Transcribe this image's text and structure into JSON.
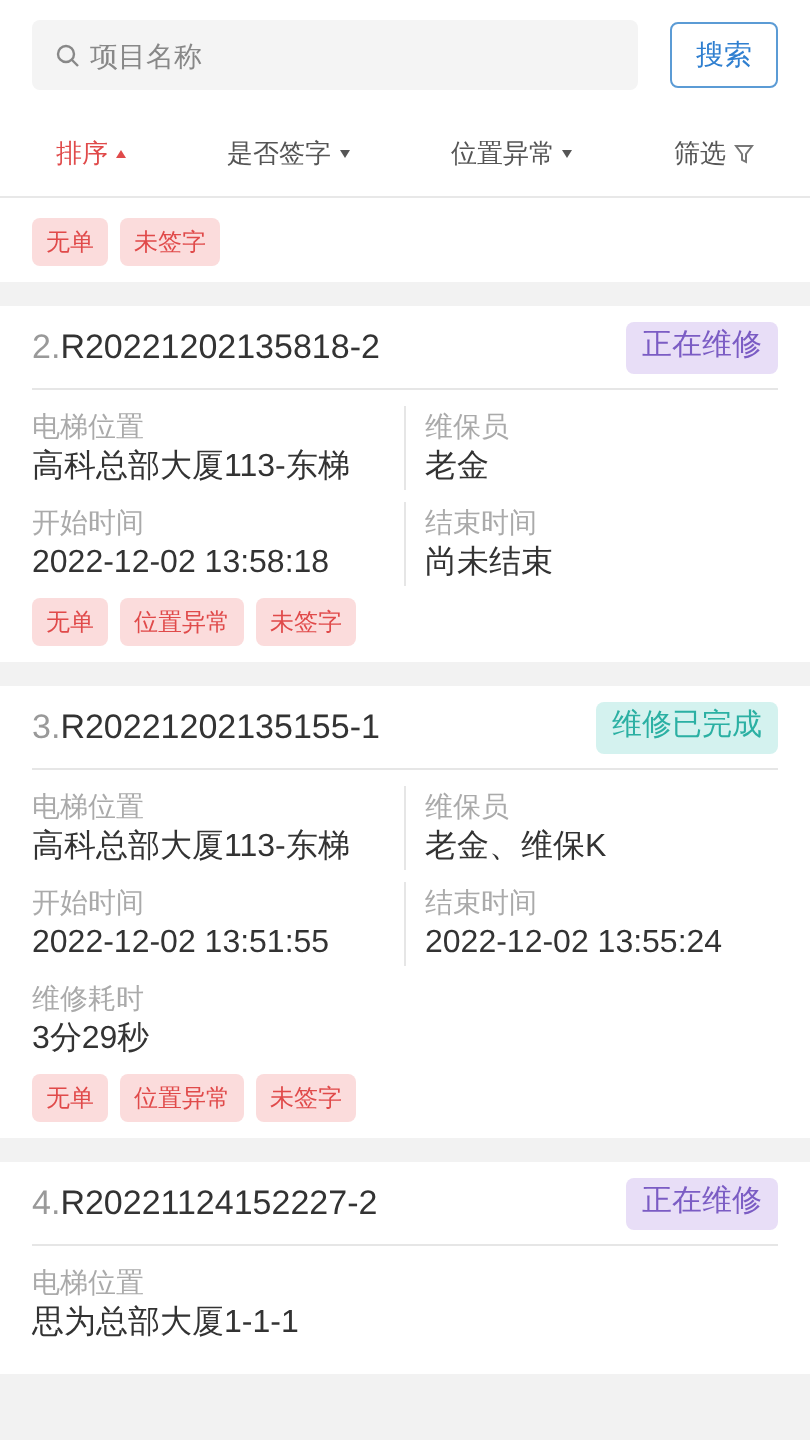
{
  "search": {
    "placeholder": "项目名称",
    "button": "搜索"
  },
  "filters": [
    {
      "label": "排序",
      "selected": true,
      "kind": "dropdown"
    },
    {
      "label": "是否签字",
      "selected": false,
      "kind": "dropdown"
    },
    {
      "label": "位置异常",
      "selected": false,
      "kind": "dropdown"
    },
    {
      "label": "筛选",
      "selected": false,
      "kind": "filter"
    }
  ],
  "partial_card": {
    "tags": [
      "无单",
      "未签字"
    ]
  },
  "orders": [
    {
      "index": "2.",
      "code": "R20221202135818-2",
      "status": "正在维修",
      "kind": "in_progress",
      "fields": [
        {
          "label": "电梯位置",
          "value": "高科总部大厦113-东梯"
        },
        {
          "label": "维保员",
          "value": "老金"
        },
        {
          "label": "开始时间",
          "value": "2022-12-02 13:58:18"
        },
        {
          "label": "结束时间",
          "value": "尚未结束"
        }
      ],
      "tags": [
        "无单",
        "位置异常",
        "未签字"
      ]
    },
    {
      "index": "3.",
      "code": "R20221202135155-1",
      "status": "维修已完成",
      "kind": "done",
      "fields": [
        {
          "label": "电梯位置",
          "value": "高科总部大厦113-东梯"
        },
        {
          "label": "维保员",
          "value": "老金、维保K"
        },
        {
          "label": "开始时间",
          "value": "2022-12-02 13:51:55"
        },
        {
          "label": "结束时间",
          "value": "2022-12-02 13:55:24"
        },
        {
          "label": "维修耗时",
          "value": "3分29秒"
        }
      ],
      "tags": [
        "无单",
        "位置异常",
        "未签字"
      ]
    },
    {
      "index": "4.",
      "code": "R20221124152227-2",
      "status": "正在维修",
      "kind": "in_progress",
      "fields": [
        {
          "label": "电梯位置",
          "value": "思为总部大厦1-1-1"
        }
      ]
    }
  ]
}
